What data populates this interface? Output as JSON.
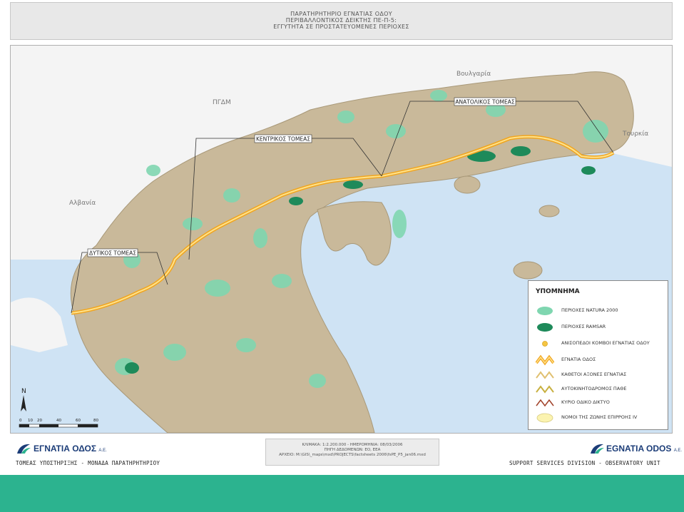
{
  "header": {
    "line1": "ΠΑΡΑΤΗΡΗΤΗΡΙΟ ΕΓΝΑΤΙΑΣ ΟΔΟΥ",
    "line2": "ΠΕΡΙΒΑΛΛΟΝΤΙΚΟΣ ΔΕΙΚΤΗΣ ΠΕ-Π-5:",
    "line3": "ΕΓΓΥΤΗΤΑ ΣΕ ΠΡΟΣΤΑΤΕΥΟΜΕΝΕΣ ΠΕΡΙΟΧΕΣ"
  },
  "map": {
    "country_labels": [
      "Βουλγαρία",
      "ΠΓΔΜ",
      "Αλβανία",
      "Τουρκία"
    ],
    "sector_labels": [
      "ΑΝΑΤΟΛΙΚΟΣ ΤΟΜΕΑΣ",
      "ΚΕΝΤΡΙΚΟΣ ΤΟΜΕΑΣ",
      "ΔΥΤΙΚΟΣ ΤΟΜΕΑΣ"
    ],
    "north_label": "N",
    "scale_ticks": [
      "0",
      "10",
      "20",
      "40",
      "60",
      "80"
    ]
  },
  "legend": {
    "title": "ΥΠΟΜΝΗΜΑ",
    "items": [
      {
        "label": "ΠΕΡΙΟΧΕΣ NATURA 2000",
        "color": "#7fd6b0"
      },
      {
        "label": "ΠΕΡΙΟΧΕΣ RAMSAR",
        "color": "#1e8a5a"
      },
      {
        "label": "ΑΝΙΣΟΠΕΔΟΙ ΚΟΜΒΟΙ ΕΓΝΑΤΙΑΣ ΟΔΟΥ",
        "color": "#f5c542"
      },
      {
        "label": "ΕΓΝΑΤΙΑ ΟΔΟΣ",
        "color": "#f0a520"
      },
      {
        "label": "ΚΑΘΕΤΟΙ ΑΞΟΝΕΣ ΕΓΝΑΤΙΑΣ",
        "color": "#e0c070"
      },
      {
        "label": "ΑΥΤΟΚΙΝΗΤΟΔΡΟΜΟΣ ΠΑΘΕ",
        "color": "#c8b040"
      },
      {
        "label": "ΚΥΡΙΟ ΟΔΙΚΟ ΔΙΚΤΥΟ",
        "color": "#a04028"
      },
      {
        "label": "ΝΟΜΟΙ ΤΗΣ ΖΩΝΗΣ ΕΠΙΡΡΟΗΣ IV",
        "color": "#fbf3b0"
      }
    ]
  },
  "footer": {
    "meta_line1": "ΚΛΙΜΑΚΑ: 1:2.200.000 - ΗΜΕΡΟΜΗΝΙΑ: 08/03/2006",
    "meta_line2": "ΠΗΓΗ ΔΕΔΟΜΕΝΩΝ: ΕΟ, ΕΕΑ",
    "meta_line3": "ΑΡΧΕΙΟ: M:\\GIS\\_maps\\mxd\\PROJECTS\\factsheets 2006\\fsPE_P5_jan06.mxd",
    "logo_left": "ΕΓΝΑΤΙΑ ΟΔΟΣ",
    "logo_left_sub": "Α.Ε.",
    "logo_right": "EGNATIA ODOS",
    "logo_right_sub": "A.E.",
    "caption_left": "ΤΟΜΕΑΣ ΥΠΟΣΤΗΡΙΞΗΣ - ΜΟΝΑΔΑ ΠΑΡΑΤΗΡΗΤΗΡΙΟΥ",
    "caption_right": "SUPPORT SERVICES DIVISION - OBSERVATORY UNIT"
  },
  "colors": {
    "sea": "#cfe3f4",
    "land_greece": "#c9b99a",
    "land_neighbors": "#f2f2f2",
    "natura": "#7fd6b0",
    "egnatia": "#f0a520",
    "band": "#2cb38f"
  }
}
